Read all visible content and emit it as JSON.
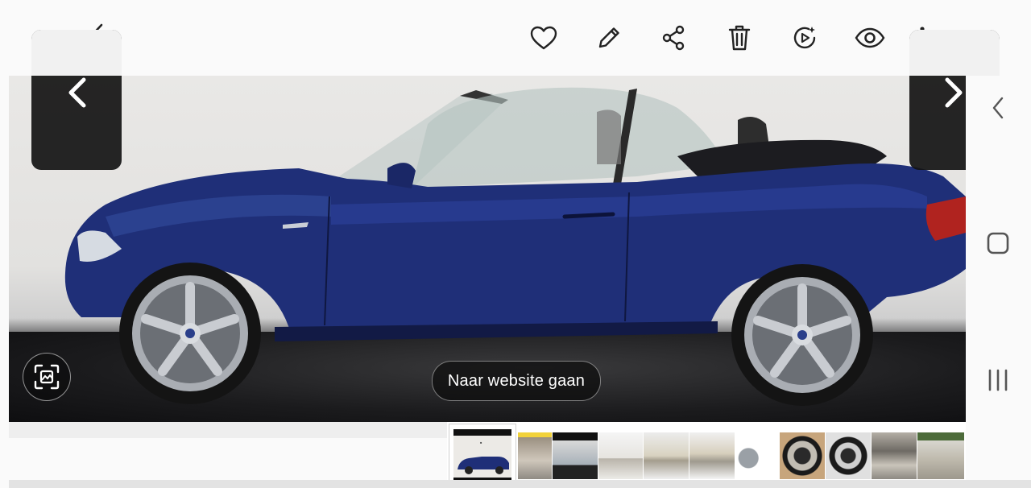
{
  "viewer": {
    "website_button_label": "Naar website gaan"
  },
  "toolbar": {
    "icons": [
      "back-icon",
      "heart-icon",
      "edit-icon",
      "share-icon",
      "delete-icon",
      "remaster-icon",
      "view-icon",
      "more-icon"
    ]
  },
  "colors": {
    "car_body": "#1f2f78",
    "nav_panel": "#141414",
    "background": "#fafafa"
  },
  "thumbnails": {
    "count": 12,
    "selected_index": 0
  }
}
